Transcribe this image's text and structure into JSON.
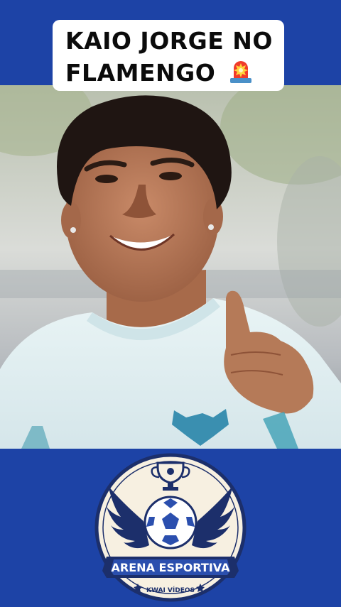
{
  "header": {
    "title_line_1": "KAIO JORGE NO",
    "title_line_2": "FLAMENGO",
    "title_emoji_icon": "police-siren-icon"
  },
  "photo": {
    "subject": "player-thumbs-up-photo"
  },
  "logo": {
    "name": "ARENA ESPORTIVA",
    "tagline": "KWAI VÍDEOS",
    "icons": [
      "trophy-icon",
      "soccer-ball-icon",
      "wings-icon",
      "star-icon"
    ]
  },
  "colors": {
    "background_blue": "#1d43a6",
    "logo_navy": "#1c2f6b",
    "logo_cream": "#f7f0e1"
  }
}
